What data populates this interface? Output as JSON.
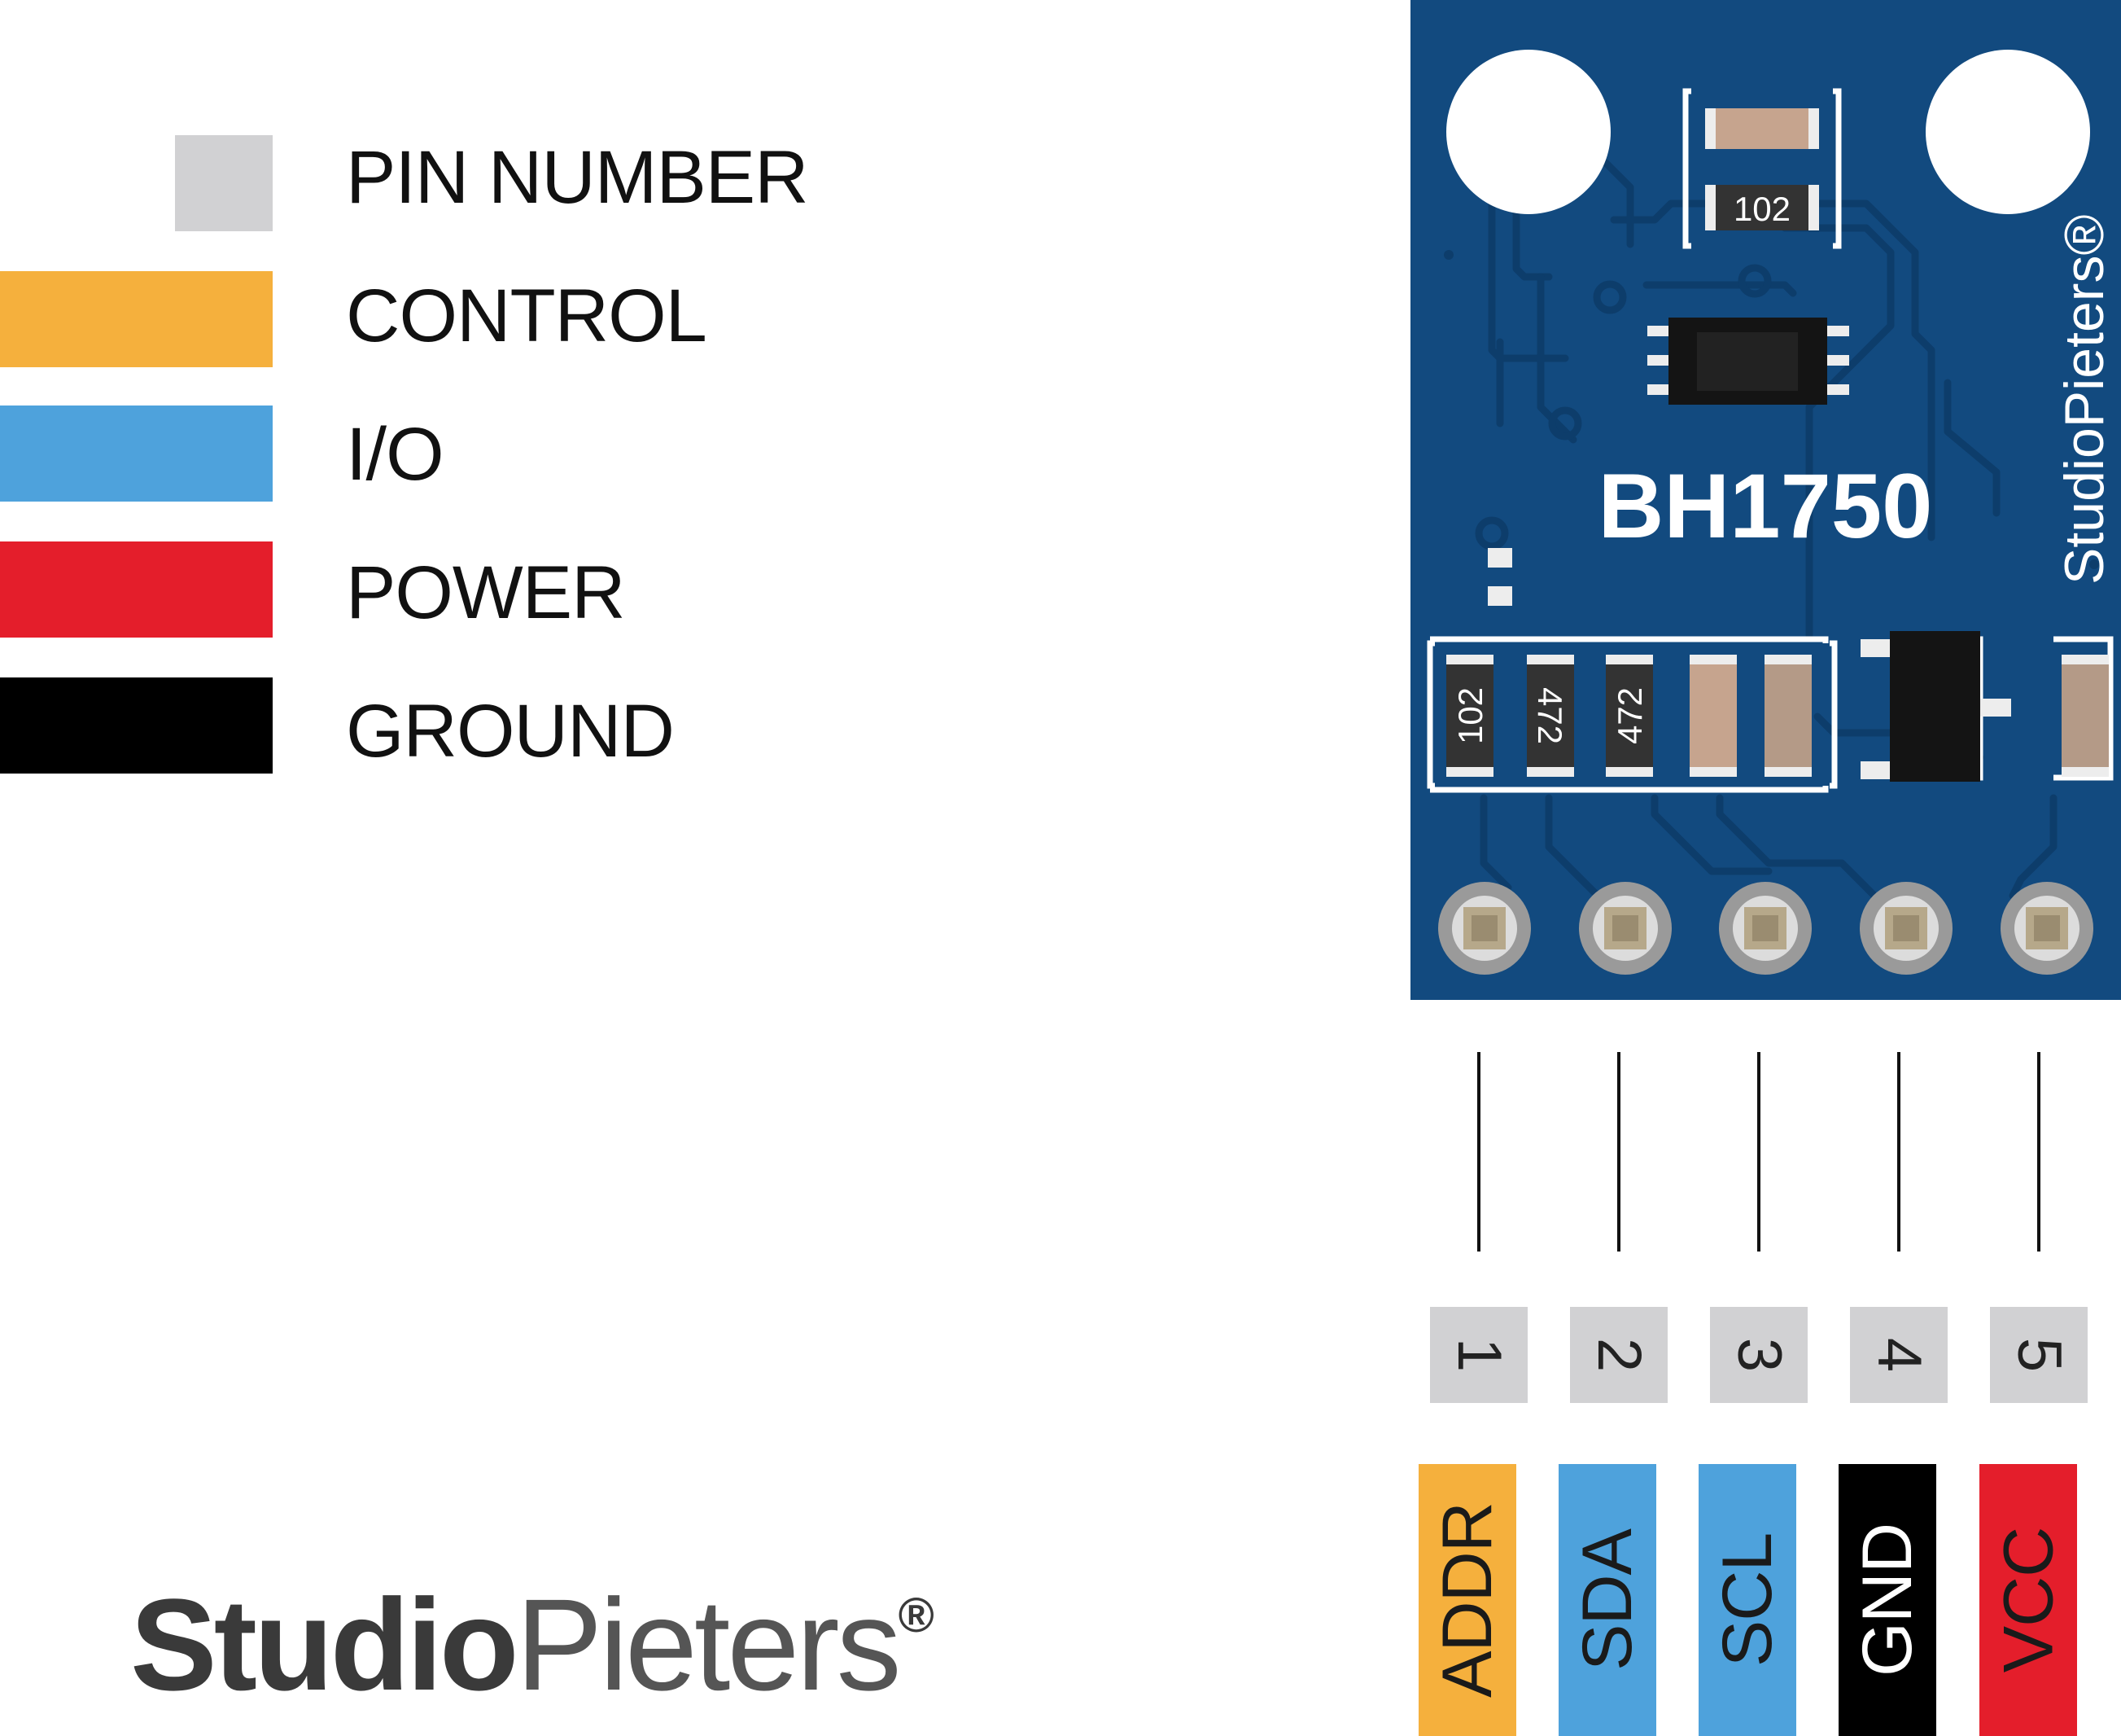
{
  "legend": [
    {
      "label": "PIN NUMBER",
      "color": "#d1d1d3"
    },
    {
      "label": "CONTROL",
      "color": "#f5b03d"
    },
    {
      "label": "I/O",
      "color": "#4ea2dc"
    },
    {
      "label": "POWER",
      "color": "#e41e2b"
    },
    {
      "label": "GROUND",
      "color": "#000000"
    }
  ],
  "brand": {
    "part1": "Studio",
    "part2": "Pieters",
    "mark": "®"
  },
  "board": {
    "title": "BH1750",
    "brand_vertical": "StudioPieters®",
    "color": "#124a7f",
    "resistor_top": "102",
    "resistors_row": [
      "102",
      "472",
      "472"
    ]
  },
  "pins": [
    {
      "number": "1",
      "name": "ADDR",
      "type": "CONTROL",
      "color": "#f5b03d",
      "text_color": "#1a1a1a"
    },
    {
      "number": "2",
      "name": "SDA",
      "type": "I/O",
      "color": "#4ea2dc",
      "text_color": "#1a1a1a"
    },
    {
      "number": "3",
      "name": "SCL",
      "type": "I/O",
      "color": "#4ea2dc",
      "text_color": "#1a1a1a"
    },
    {
      "number": "4",
      "name": "GND",
      "type": "GROUND",
      "color": "#000000",
      "text_color": "#ffffff"
    },
    {
      "number": "5",
      "name": "VCC",
      "type": "POWER",
      "color": "#e41e2b",
      "text_color": "#1a1a1a"
    }
  ]
}
